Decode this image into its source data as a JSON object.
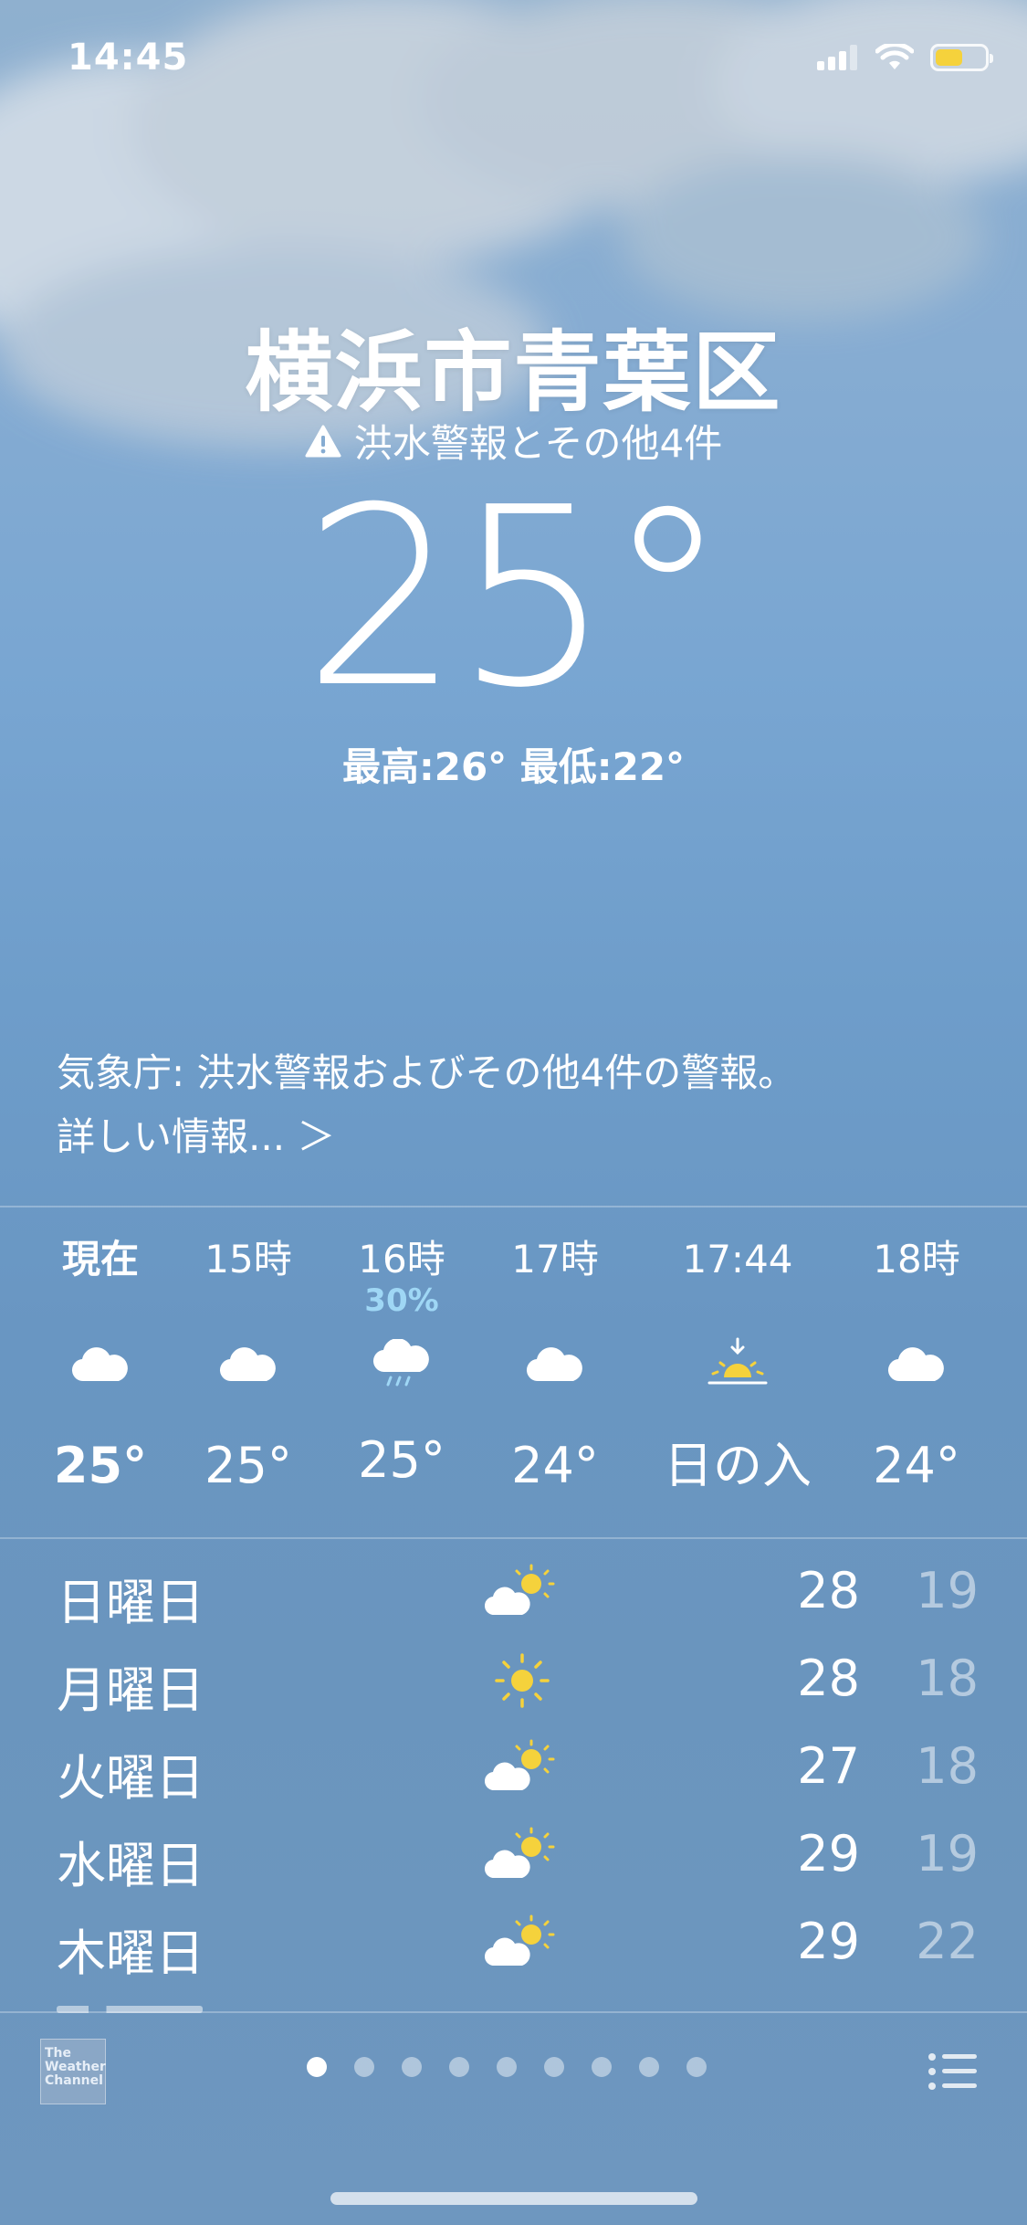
{
  "status_bar": {
    "time": "14:45",
    "signal_icon": "cellular-signal-icon",
    "wifi_icon": "wifi-icon",
    "battery_level": 0.55,
    "battery_color": "#f5d23c"
  },
  "header": {
    "city": "横浜市青葉区",
    "alert_icon": "warning-triangle-icon",
    "alert_text": "洪水警報とその他4件",
    "current_temp": "25°",
    "high_low": "最高:26° 最低:22°"
  },
  "summary": {
    "line1": "気象庁: 洪水警報およびその他4件の警報。",
    "line2": "詳しい情報... ＞"
  },
  "hourly": [
    {
      "label": "現在",
      "pop": "",
      "icon": "cloud-icon",
      "temp": "25°"
    },
    {
      "label": "15時",
      "pop": "",
      "icon": "cloud-icon",
      "temp": "25°"
    },
    {
      "label": "16時",
      "pop": "30%",
      "icon": "cloud-rain-icon",
      "temp": "25°"
    },
    {
      "label": "17時",
      "pop": "",
      "icon": "cloud-icon",
      "temp": "24°"
    },
    {
      "label": "17:44",
      "pop": "",
      "icon": "sunset-icon",
      "temp": "日の入"
    },
    {
      "label": "18時",
      "pop": "",
      "icon": "cloud-icon",
      "temp": "24°"
    }
  ],
  "daily": [
    {
      "day": "日曜日",
      "icon": "partly-sunny-icon",
      "high": "28",
      "low": "19"
    },
    {
      "day": "月曜日",
      "icon": "sun-icon",
      "high": "28",
      "low": "18"
    },
    {
      "day": "火曜日",
      "icon": "partly-sunny-icon",
      "high": "27",
      "low": "18"
    },
    {
      "day": "水曜日",
      "icon": "partly-sunny-icon",
      "high": "29",
      "low": "19"
    },
    {
      "day": "木曜日",
      "icon": "partly-sunny-icon",
      "high": "29",
      "low": "22"
    }
  ],
  "bottom_bar": {
    "logo_text": "The Weather Channel",
    "page_count": 9,
    "active_page": 1,
    "list_icon": "list-icon"
  },
  "colors": {
    "precip": "#9fd7f5",
    "sun": "#f5d23c"
  }
}
